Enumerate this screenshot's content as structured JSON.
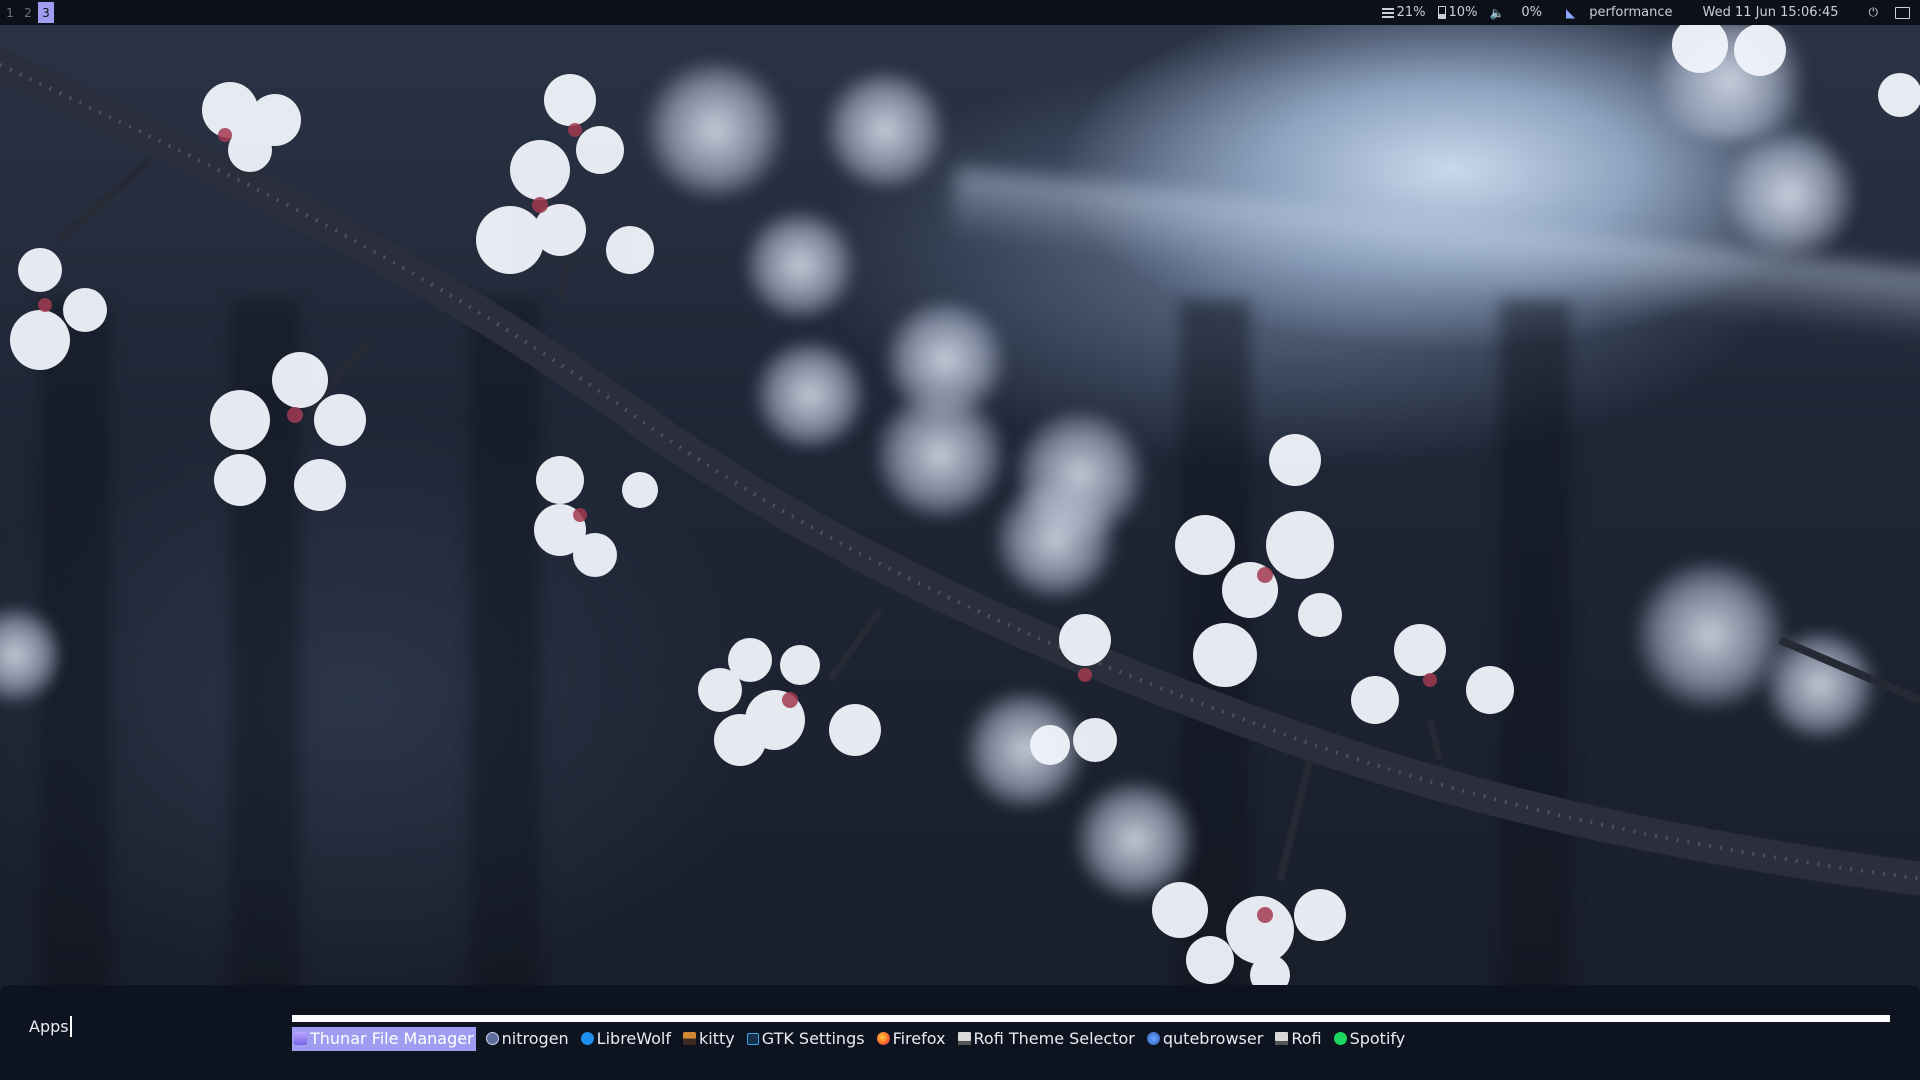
{
  "topbar": {
    "workspaces": [
      "1",
      "2",
      "3"
    ],
    "active_workspace": "3",
    "cpu": "21%",
    "battery": "10%",
    "volume": "0%",
    "governor": "performance",
    "datetime": "Wed 11 Jun 15:06:45"
  },
  "rofi": {
    "prompt": "Apps",
    "input_value": "",
    "selected_item": "Thunar File Manager",
    "items": [
      {
        "label": "Thunar File Manager",
        "icon": "thunar-icon"
      },
      {
        "label": "nitrogen",
        "icon": "nitrogen-icon"
      },
      {
        "label": "LibreWolf",
        "icon": "librewolf-icon"
      },
      {
        "label": "kitty",
        "icon": "kitty-icon"
      },
      {
        "label": "GTK Settings",
        "icon": "gtk-settings-icon"
      },
      {
        "label": "Firefox",
        "icon": "firefox-icon"
      },
      {
        "label": "Rofi Theme Selector",
        "icon": "rofi-theme-icon"
      },
      {
        "label": "qutebrowser",
        "icon": "qutebrowser-icon"
      },
      {
        "label": "Rofi",
        "icon": "rofi-icon"
      },
      {
        "label": "Spotify",
        "icon": "spotify-icon"
      }
    ]
  },
  "colors": {
    "accent": "#9f9df2",
    "bar_bg": "#0c1019",
    "launcher_bg": "#0d1420",
    "text": "#e8ebf2"
  }
}
